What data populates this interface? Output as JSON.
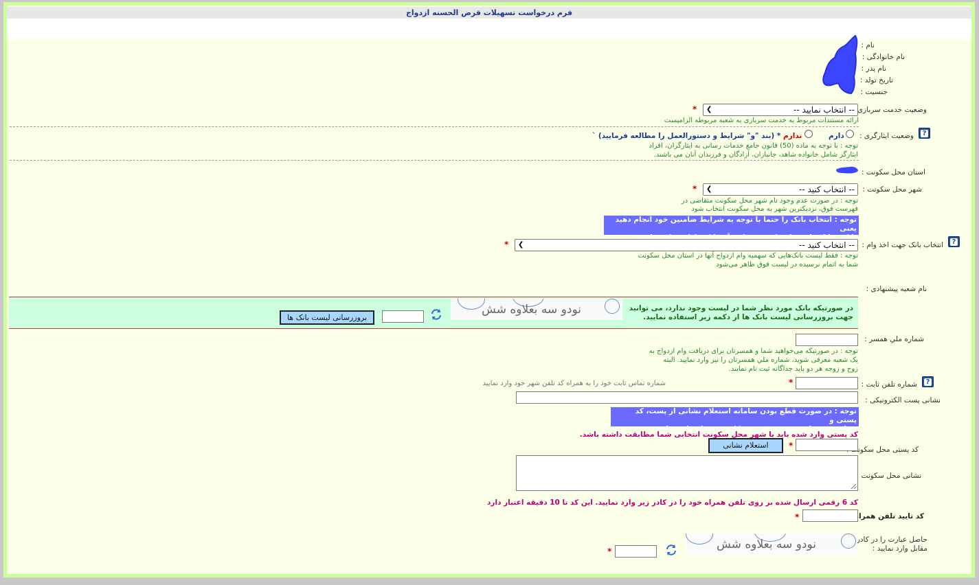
{
  "form": {
    "title": "فرم درخواست تسهیلات قرض الحسنه ازدواج"
  },
  "personal": {
    "first_name_label": "نام :",
    "last_name_label": "نام خانوادگی :",
    "father_name_label": "نام پدر :",
    "birth_date_label": "تاریخ تولد :",
    "gender_label": "جنسیت :"
  },
  "military": {
    "label": "وضعیت خدمت سربازی :",
    "select_value": "-- انتخاب نمایید --",
    "note": "ارائه مستندات مربوط به خدمت سربازی به شعبه مربوطه الزامیست"
  },
  "veteran": {
    "label": "وضعیت ایثارگری :",
    "option_yes": "دارم",
    "option_no": "ندارم",
    "rules_link": "* (بند \"و\" شرایط و دستورالعمل را مطالعه فرمایید) `",
    "note_line1": "توجه : با توجه به ماده (50) قانون جامع خدمات رسانی به ایثارگران، افراد",
    "note_line2": "ایثارگر شامل خانواده شاهد، جانبازان، آزادگان و فرزندان آنان می باشند."
  },
  "province": {
    "label": "استان محل سکونت :"
  },
  "city": {
    "label": "شهر محل سکونت :",
    "select_value": "-- انتخاب کنید --",
    "note_line1": "توجه : در صورت عدم وجود نام شهر محل سکونت متقاضی در",
    "note_line2": "فهرست فوق، نزدیکترین شهر به محل سکونت انتخاب شود"
  },
  "bank": {
    "highlight_line1": "توجه : انتخاب بانک را حتما با توجه به شرایط ضامنین خود انجام دهید یعنی",
    "highlight_line2": "بانکی را انتخاب نمایید که ترجیحا در آن بانک دارای ضامن باشید.",
    "label": "انتخاب بانک جهت اخذ وام :",
    "select_value": "-- انتخاب کنید --",
    "note_line1": "توجه : فقط لیست بانک‌هایی که سهمیه وام ازدواج آنها در استان محل سکونت",
    "note_line2": "شما به اتمام نرسیده در لیست فوق ظاهر می‌شود"
  },
  "branch": {
    "label": "نام شعبه پیشنهادی :"
  },
  "refresh_box": {
    "message_line1": "در صورتیکه بانک مورد نظر شما در لیست وجود ندارد، می توانید",
    "message_line2": "جهت بروزرسانی لیست بانک ها از دکمه زیر استفاده نمایید.",
    "captcha_text": "نودو سه بعلاوه شش",
    "button_label": "بروزرسانی لیست بانک ها"
  },
  "spouse": {
    "label": "شماره ملي همسر :",
    "note_line1": "توجه : در صورتیکه می‌خواهید شما و همسرتان برای دریافت وام ازدواج به",
    "note_line2": "یک شعبه معرفی شوید، شماره ملي همسرتان را نیز وارد نمایید. البته",
    "note_line3": "زوج و زوجه هر دو باید جداگانه ثبت نام نمایند."
  },
  "phone": {
    "label": "شماره تلفن ثابت :",
    "hint": "شماره تماس ثابت خود را به همراه کد تلفن شهر خود وارد نمایید"
  },
  "email": {
    "label": "نشانی پست الکترونیکی :"
  },
  "postal": {
    "highlight_line1": "توجه : در صورت قطع بودن سامانه استعلام نشانی از پست، کد پستی و",
    "highlight_line2": "نشانی خود را به صورت دقیق در کادر مربوطه وارد نمایید.",
    "warning": "کد پستی وارد شده باید با شهر محل سکونت انتخابی شما مطابقت داشته باشد.",
    "label": "کد پستی محل سکونت :",
    "button_label": "استعلام نشانی"
  },
  "address": {
    "label": "نشانی محل سکونت :"
  },
  "mobile": {
    "sms_note": "کد 6 رقمی ارسال شده بر روی تلفن همراه خود را در کادر زیر وارد نمایید. این کد تا 10 دقیقه اعتبار دارد",
    "label": "کد تایید تلفن همراه :"
  },
  "final_captcha": {
    "label_line1": "حاصل عبارت را در کادر",
    "label_line2": "مقابل وارد نمایید :",
    "captcha_text": "نودو سه بعلاوه شش"
  },
  "required_mark": "*",
  "colors": {
    "frame_border": "#ccff99",
    "page_bg": "#fbffe8",
    "title_color": "#1c3c8c",
    "note_green": "#2b8a2b",
    "highlight_bg": "#6b6bff",
    "refresh_box_bg": "#ccffe0",
    "warning_magenta": "#c0007a",
    "button_bg": "#a9d6ff"
  },
  "icons": {
    "help": "question-help-icon",
    "refresh": "refresh-captcha-icon",
    "redaction": "redaction-scribble"
  }
}
